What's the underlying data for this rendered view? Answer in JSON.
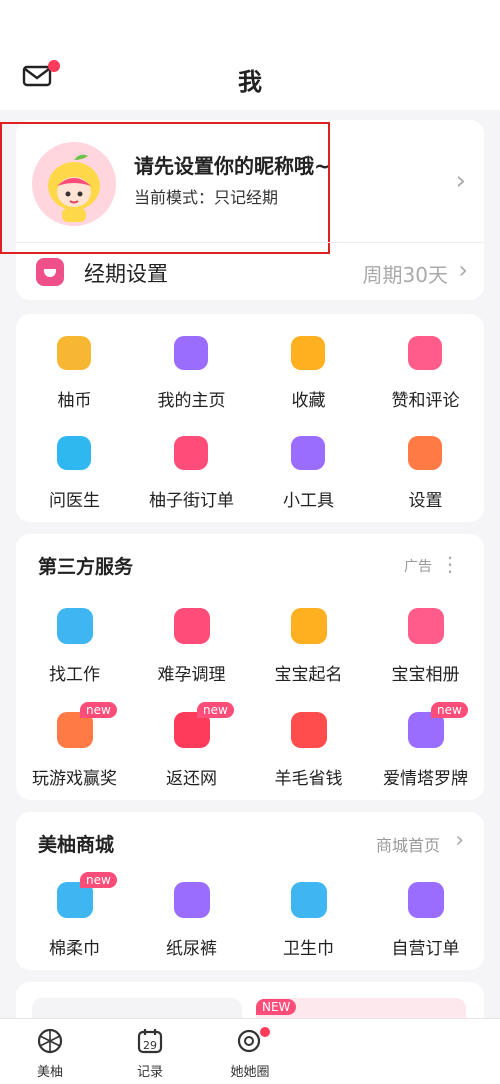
{
  "header": {
    "title": "我",
    "mail_icon": "mail-icon",
    "has_notification": true
  },
  "profile": {
    "nickname": "请先设置你的昵称哦~",
    "mode_text": "当前模式：只记经期",
    "avatar_icon": "cartoon-girl-avatar"
  },
  "period": {
    "label": "经期设置",
    "value": "周期30天"
  },
  "shortcuts": [
    {
      "label": "柚币",
      "icon": "coin-icon",
      "color": "#f7b733"
    },
    {
      "label": "我的主页",
      "icon": "person-icon",
      "color": "#9b6dff"
    },
    {
      "label": "收藏",
      "icon": "star-icon",
      "color": "#ffb020"
    },
    {
      "label": "赞和评论",
      "icon": "thumbs-up-icon",
      "color": "#ff5c8a"
    },
    {
      "label": "问医生",
      "icon": "doctor-icon",
      "color": "#2fb8f0"
    },
    {
      "label": "柚子街订单",
      "icon": "order-icon",
      "color": "#ff4d7a"
    },
    {
      "label": "小工具",
      "icon": "tools-icon",
      "color": "#9b6dff"
    },
    {
      "label": "设置",
      "icon": "gear-icon",
      "color": "#ff7a45"
    }
  ],
  "third_party": {
    "title": "第三方服务",
    "ad_label": "广告",
    "items": [
      {
        "label": "找工作",
        "icon": "briefcase-icon",
        "color": "#3fb6f2",
        "new": false
      },
      {
        "label": "难孕调理",
        "icon": "flower-icon",
        "color": "#ff4d7a",
        "new": false
      },
      {
        "label": "宝宝起名",
        "icon": "book-icon",
        "color": "#ffb020",
        "new": false
      },
      {
        "label": "宝宝相册",
        "icon": "album-icon",
        "color": "#ff5c8a",
        "new": false
      },
      {
        "label": "玩游戏赢奖",
        "icon": "game-icon",
        "color": "#ff7a45",
        "new": true
      },
      {
        "label": "返还网",
        "icon": "rebate-icon",
        "color": "#ff3b5c",
        "new": true
      },
      {
        "label": "羊毛省钱",
        "icon": "wool-money-icon",
        "color": "#ff4d4d",
        "new": false
      },
      {
        "label": "爱情塔罗牌",
        "icon": "tarot-icon",
        "color": "#9b6dff",
        "new": true
      }
    ],
    "new_tag": "new"
  },
  "mall": {
    "title": "美柚商城",
    "link": "商城首页",
    "items": [
      {
        "label": "棉柔巾",
        "icon": "tissue-icon",
        "color": "#3fb6f2",
        "new": true
      },
      {
        "label": "纸尿裤",
        "icon": "diaper-icon",
        "color": "#9b6dff",
        "new": false
      },
      {
        "label": "卫生巾",
        "icon": "pad-icon",
        "color": "#3fb6f2",
        "new": false
      },
      {
        "label": "自营订单",
        "icon": "order-list-icon",
        "color": "#9b6dff",
        "new": false
      }
    ],
    "new_tag": "new"
  },
  "banner": {
    "new_tag": "NEW"
  },
  "tabbar": {
    "tabs": [
      {
        "label": "美柚",
        "icon": "home-ball-icon"
      },
      {
        "label": "记录",
        "icon": "calendar-icon",
        "day": "29"
      },
      {
        "label": "她她圈",
        "icon": "community-icon",
        "dot": true
      }
    ]
  }
}
